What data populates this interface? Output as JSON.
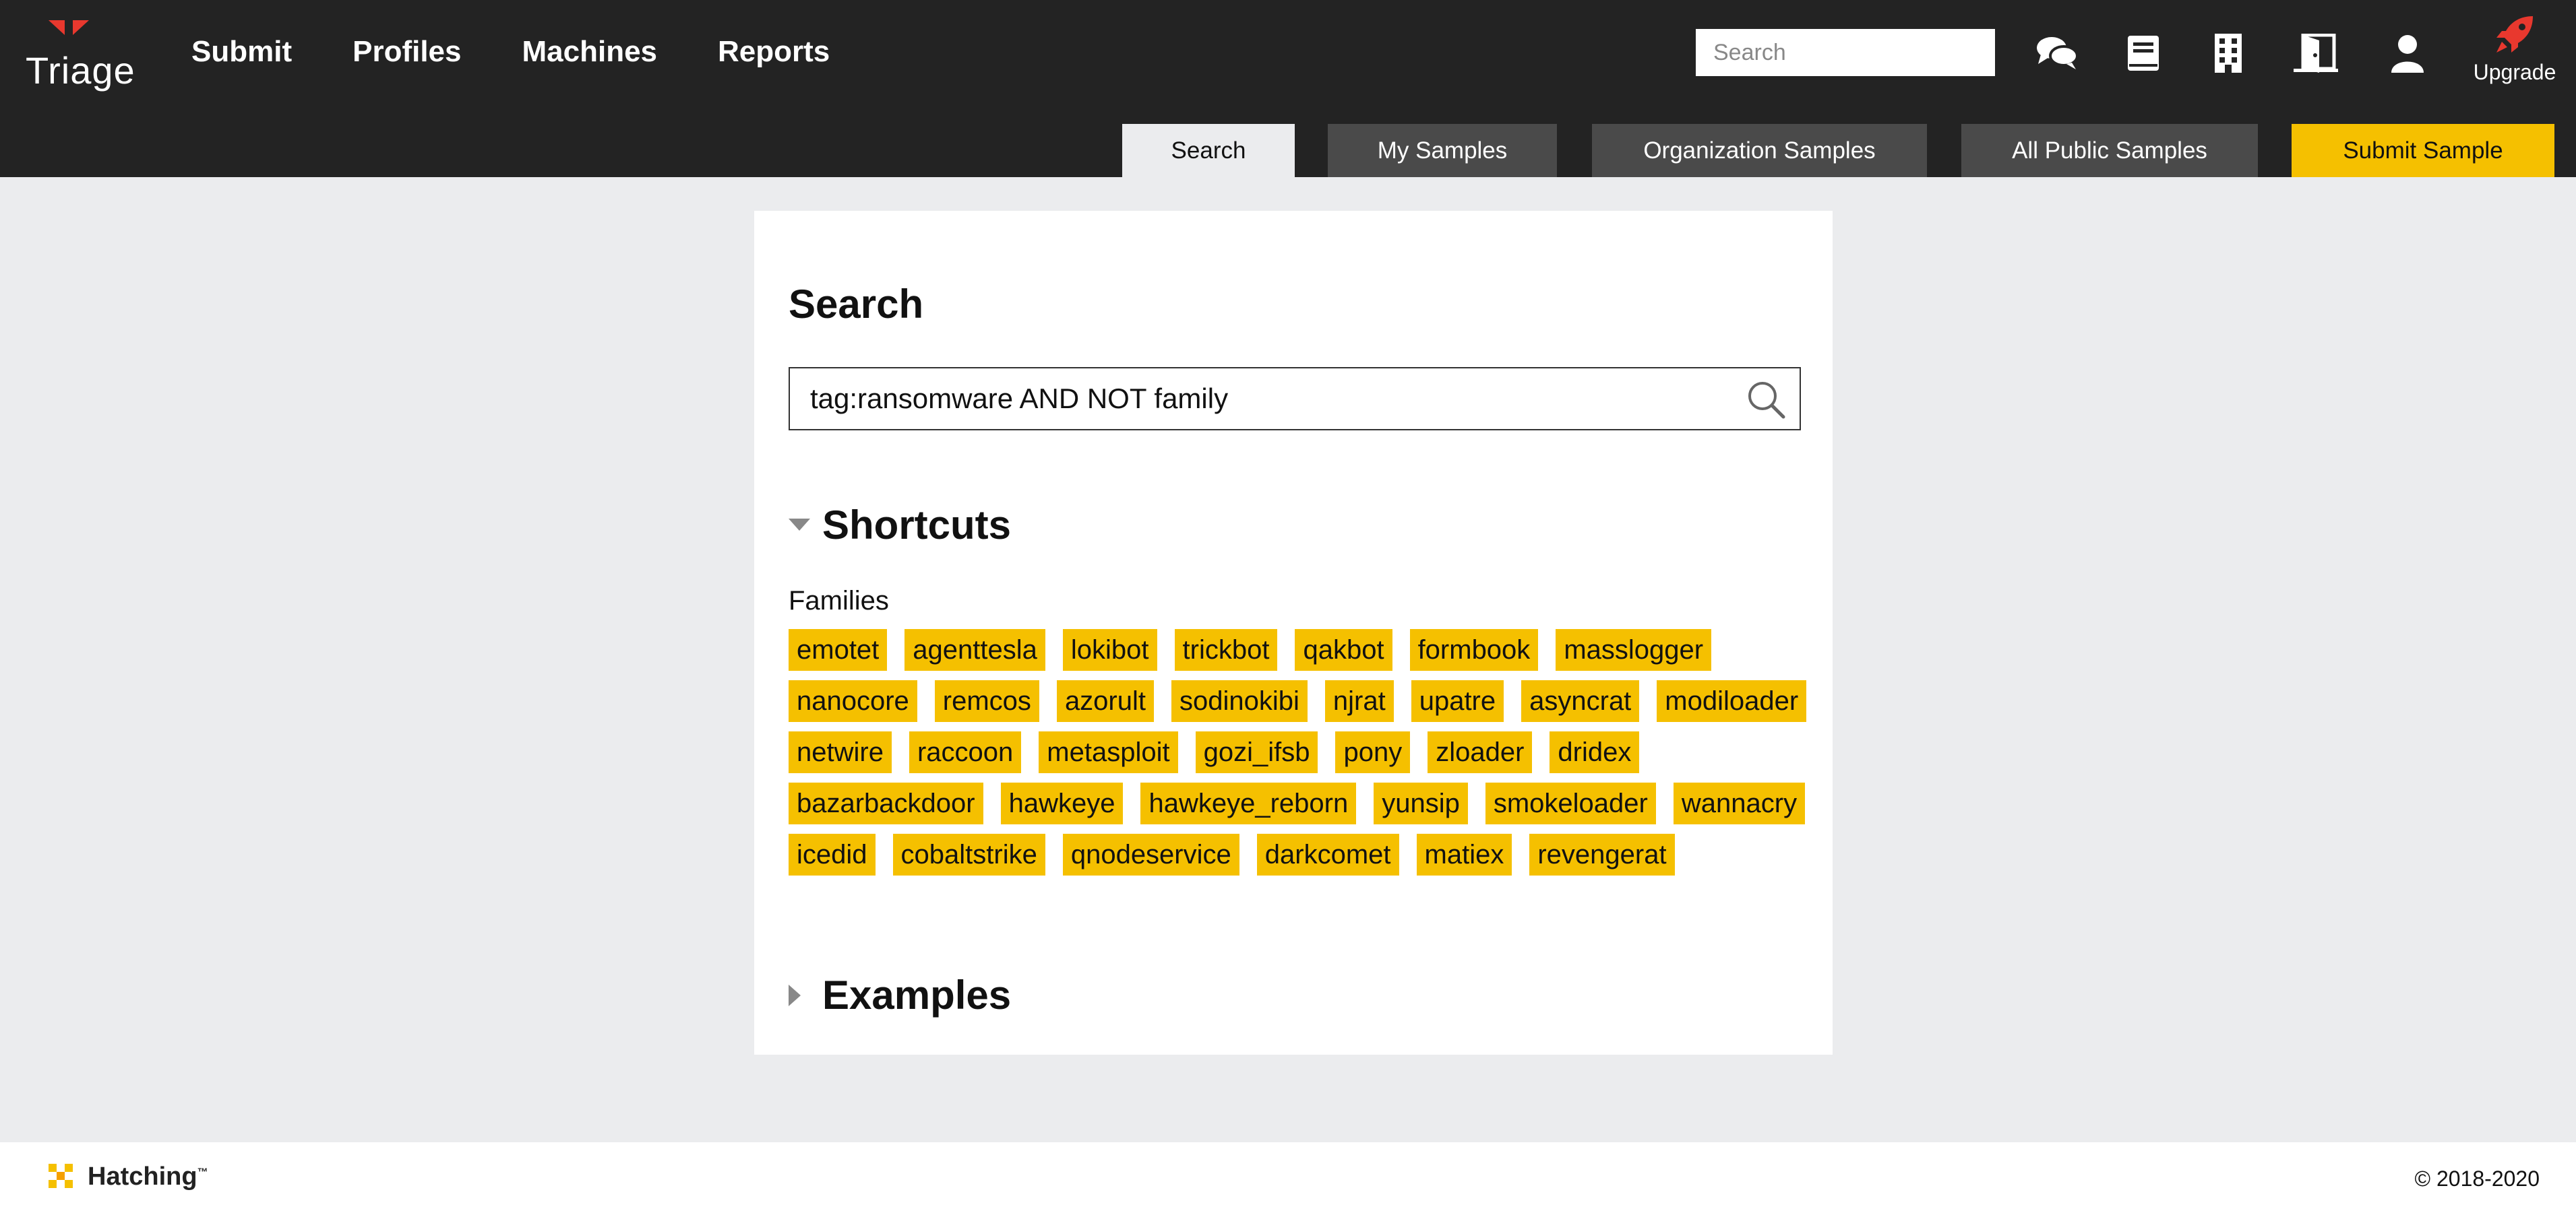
{
  "app": {
    "name": "Triage",
    "brand_color": "#e8382e",
    "accent_color": "#f5c000"
  },
  "header": {
    "nav": [
      "Submit",
      "Profiles",
      "Machines",
      "Reports"
    ],
    "search_placeholder": "Search",
    "icons": [
      "chat-icon",
      "book-icon",
      "building-icon",
      "door-icon",
      "user-icon"
    ],
    "upgrade_label": "Upgrade"
  },
  "tabs": [
    {
      "label": "Search",
      "active": true
    },
    {
      "label": "My Samples"
    },
    {
      "label": "Organization Samples"
    },
    {
      "label": "All Public Samples"
    },
    {
      "label": "Submit Sample"
    }
  ],
  "main": {
    "title": "Search",
    "query": "tag:ransomware AND NOT family",
    "shortcuts": {
      "title": "Shortcuts",
      "expanded": true,
      "families_label": "Families",
      "families": [
        "emotet",
        "agenttesla",
        "lokibot",
        "trickbot",
        "qakbot",
        "formbook",
        "masslogger",
        "nanocore",
        "remcos",
        "azorult",
        "sodinokibi",
        "njrat",
        "upatre",
        "asyncrat",
        "modiloader",
        "netwire",
        "raccoon",
        "metasploit",
        "gozi_ifsb",
        "pony",
        "zloader",
        "dridex",
        "bazarbackdoor",
        "hawkeye",
        "hawkeye_reborn",
        "yunsip",
        "smokeloader",
        "wannacry",
        "icedid",
        "cobaltstrike",
        "qnodeservice",
        "darkcomet",
        "matiex",
        "revengerat"
      ]
    },
    "examples": {
      "title": "Examples",
      "expanded": false
    }
  },
  "footer": {
    "brand": "Hatching",
    "trademark": "™",
    "copyright": "© 2018-2020"
  }
}
